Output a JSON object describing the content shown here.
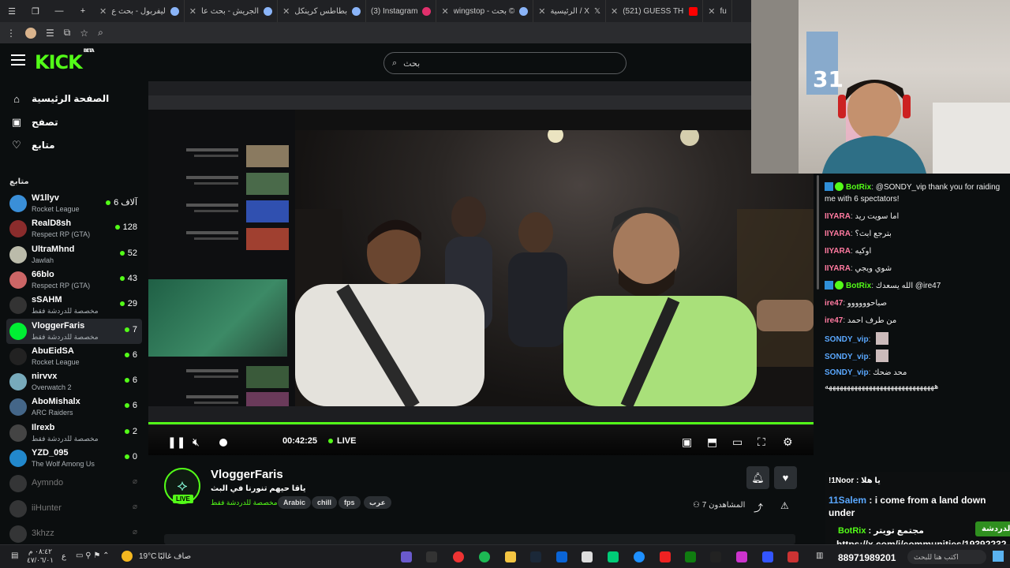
{
  "browser": {
    "tabs": [
      {
        "label": "ليفربول - بحث ع"
      },
      {
        "label": "الجريش - بحث عا"
      },
      {
        "label": "بطاطس كرينكل"
      },
      {
        "label": "(3) Instagram"
      },
      {
        "label": "wingstop - بحث ©"
      },
      {
        "label": "الرئيسية / X"
      },
      {
        "label": "(521) GUESS THE"
      },
      {
        "label": "fu"
      }
    ]
  },
  "kick": {
    "logo": "KICK",
    "logo_sup": "BETA",
    "search_placeholder": "بحث"
  },
  "sidebar": {
    "nav": [
      {
        "label": "الصفحة الرئيسية",
        "icon": "home-icon"
      },
      {
        "label": "تصفح",
        "icon": "browse-icon"
      },
      {
        "label": "متابع",
        "icon": "heart-icon"
      }
    ],
    "followed_title": "متابع",
    "channels": [
      {
        "name": "W1llyv",
        "category": "Rocket League",
        "viewers": "6 آلاف",
        "color": "#3a8fd8"
      },
      {
        "name": "RealD8sh",
        "category": "Respect RP (GTA)",
        "viewers": "128",
        "color": "#8a2c2c"
      },
      {
        "name": "UltraMhnd",
        "category": "Jawlah",
        "viewers": "52",
        "color": "#bba"
      },
      {
        "name": "66blo",
        "category": "Respect RP (GTA)",
        "viewers": "43",
        "color": "#c66"
      },
      {
        "name": "sSAHM",
        "category": "مخصصة للدردشة فقط",
        "viewers": "29",
        "color": "#333"
      },
      {
        "name": "VloggerFaris",
        "category": "مخصصة للدردشة فقط",
        "viewers": "7",
        "color": "#0e3",
        "active": true
      },
      {
        "name": "AbuEidSA",
        "category": "Rocket League",
        "viewers": "6",
        "color": "#222"
      },
      {
        "name": "nirvvx",
        "category": "Overwatch 2",
        "viewers": "6",
        "color": "#7ab"
      },
      {
        "name": "AboMishalx",
        "category": "ARC Raiders",
        "viewers": "6",
        "color": "#468"
      },
      {
        "name": "Ilrexb",
        "category": "مخصصة للدردشة فقط",
        "viewers": "2",
        "color": "#444"
      },
      {
        "name": "YZD_095",
        "category": "The Wolf Among Us",
        "viewers": "0",
        "color": "#28c"
      }
    ],
    "offline": [
      {
        "name": "Aymndo"
      },
      {
        "name": "iiHunter"
      },
      {
        "name": "3khzz"
      }
    ]
  },
  "player": {
    "time": "00:42:25",
    "live_label": "LIVE"
  },
  "channel": {
    "name": "VloggerFaris",
    "title": "ياقا حيهم تنورنا في البث",
    "category": "مخصصة للدردشة فقط",
    "live_badge": "LIVE",
    "tags": [
      "Arabic",
      "chill",
      "fps",
      "عرب"
    ],
    "viewers_label": "المشاهدون",
    "viewers_count": "7"
  },
  "chat": {
    "messages": [
      {
        "user": "BotRix",
        "text": "@SONDY_vip thank you for raiding me with 6 spectators!",
        "color": "#53fc18",
        "bot": true
      },
      {
        "user": "IIYARA",
        "text": "اما سويت ريد",
        "color": "#ff7aa0"
      },
      {
        "user": "IIYARA",
        "text": "بترجع ابث؟",
        "color": "#ff7aa0"
      },
      {
        "user": "IIYARA",
        "text": "اوكيه",
        "color": "#ff7aa0"
      },
      {
        "user": "IIYARA",
        "text": "شوي ويجي",
        "color": "#ff7aa0"
      },
      {
        "user": "BotRix",
        "text": "الله يسعدك @ire47",
        "color": "#53fc18",
        "bot": true
      },
      {
        "user": "ire47",
        "text": "صباحوووووو",
        "color": "#ff7aa0"
      },
      {
        "user": "ire47",
        "text": "من طرف احمد",
        "color": "#ff7aa0"
      },
      {
        "user": "SONDY_vip",
        "text": "",
        "color": "#5aa8ff",
        "emote": true
      },
      {
        "user": "SONDY_vip",
        "text": "",
        "color": "#5aa8ff",
        "emote": true
      },
      {
        "user": "SONDY_vip",
        "text": "محد ضحك",
        "color": "#5aa8ff"
      },
      {
        "user": "",
        "text": "ههههههههههههههههههههههههههههههه",
        "color": "#fff"
      }
    ],
    "overlay": {
      "noor": "!1Noor : يا هلا",
      "salem_user": "11Salem",
      "salem_text": ": i come from a land down under",
      "bot_user": "BotRix",
      "bot_text": ": مجتمع تويتر",
      "link": "https://x.com/i/communities/19392232",
      "phone": "88971989201",
      "chat_button": "الدردشة",
      "input_placeholder": "اكتب هنا للبحث"
    }
  },
  "taskbar": {
    "weather_temp": "19°C",
    "weather_text": "صاف غالبًا",
    "time": "٠٨:٤٢ م",
    "date": "٤٧/٠٦/٠١",
    "lang": "ع"
  },
  "colors": {
    "brand": "#53fc18",
    "bg": "#0b0e0f",
    "sidebar_active": "#24272c"
  }
}
